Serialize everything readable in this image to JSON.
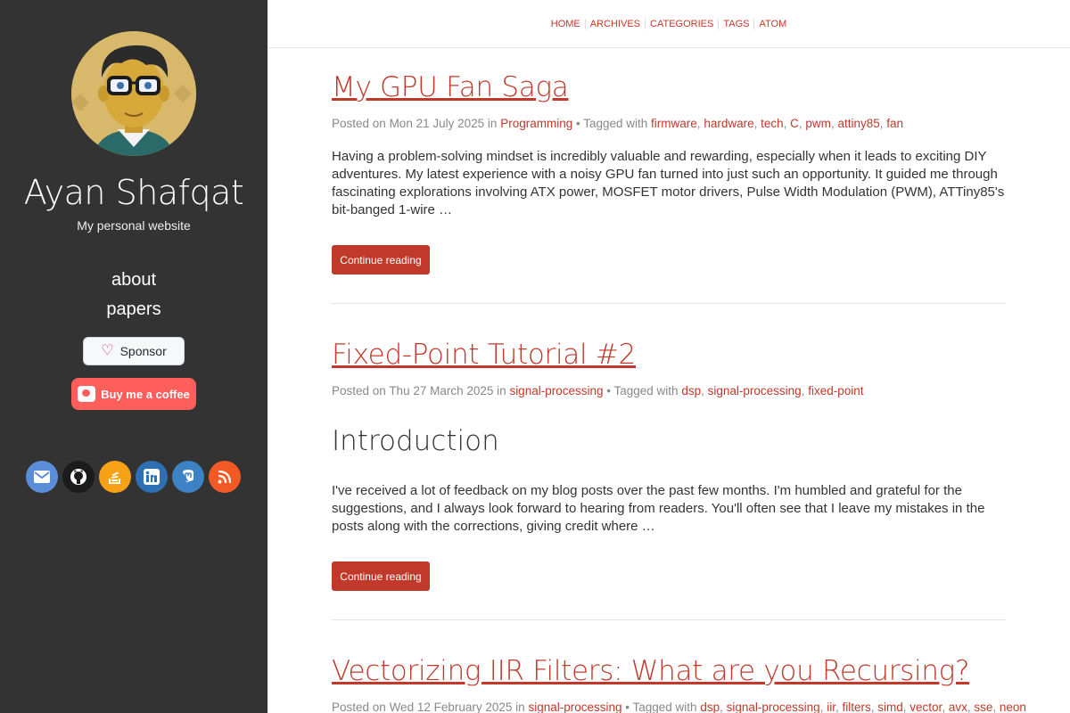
{
  "site": {
    "title": "Ayan Shafqat",
    "subtitle": "My personal website",
    "nav": [
      "about",
      "papers"
    ],
    "sponsor_label": "Sponsor",
    "coffee_label": "Buy me a coffee",
    "social_icons": [
      "envelope-icon",
      "github-icon",
      "stackoverflow-icon",
      "linkedin-icon",
      "mastodon-icon",
      "rss-icon"
    ]
  },
  "topnav": [
    "HOME",
    "ARCHIVES",
    "CATEGORIES",
    "TAGS",
    "ATOM"
  ],
  "posts": [
    {
      "title": "My GPU Fan Saga",
      "posted_prefix": "Posted on",
      "date": "Mon 21 July 2025",
      "in_word": "in",
      "category": "Programming",
      "tagged": "Tagged with",
      "tags": [
        "firmware",
        "hardware",
        "tech",
        "C",
        "pwm",
        "attiny85",
        "fan"
      ],
      "summary": "Having a problem-solving mindset is incredibly valuable and rewarding, especially when it leads to exciting DIY adventures. My latest experience with a noisy GPU fan turned into just such an opportunity. It guided me through fascinating explorations involving ATX power, MOSFET motor drivers, Pulse Width Modulation (PWM), ATTiny85's bit-banged 1-wire …",
      "button": "Continue reading"
    },
    {
      "title": "Fixed-Point Tutorial #2",
      "posted_prefix": "Posted on",
      "date": "Thu 27 March 2025",
      "in_word": "in",
      "category": "signal-processing",
      "tagged": "Tagged with",
      "tags": [
        "dsp",
        "signal-processing",
        "fixed-point"
      ],
      "heading": "Introduction",
      "summary": "I've received a lot of feedback on my blog posts over the past few months. I'm humbled and grateful for the suggestions, and I always look forward to hearing from readers. You'll often see that I leave my mistakes in the posts along with the corrections, giving credit where …",
      "button": "Continue reading"
    },
    {
      "title": "Vectorizing IIR Filters: What are you Recursing?",
      "posted_prefix": "Posted on",
      "date": "Wed 12 February 2025",
      "in_word": "in",
      "category": "signal-processing",
      "tagged": "Tagged with",
      "tags": [
        "dsp",
        "signal-processing",
        "iir",
        "filters",
        "simd",
        "vector",
        "avx",
        "sse",
        "neon"
      ]
    }
  ],
  "colors": {
    "accent": "#c0392b",
    "sidebar": "#333333"
  }
}
